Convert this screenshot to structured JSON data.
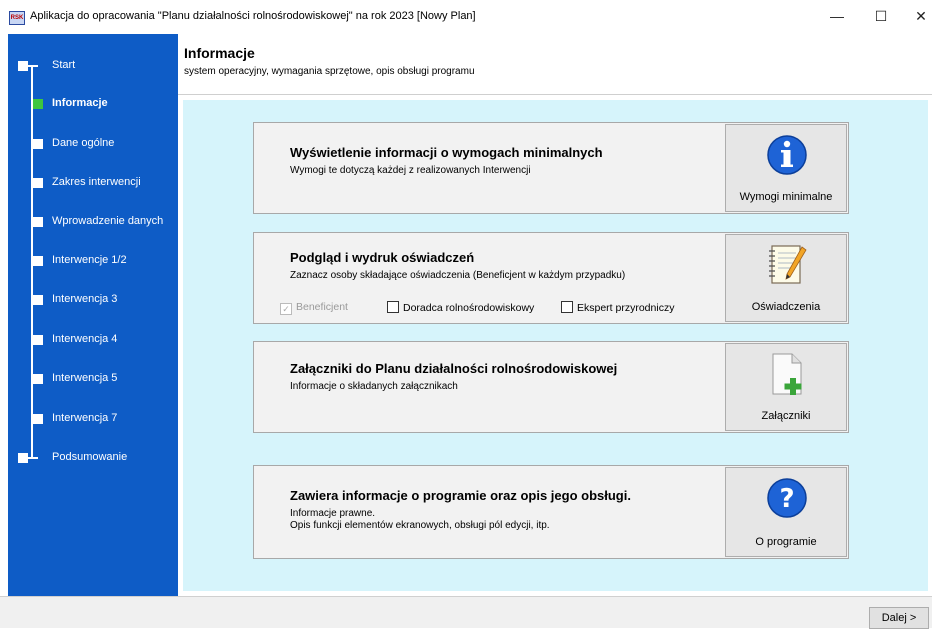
{
  "window": {
    "title": "Aplikacja do opracowania \"Planu działalności rolnośrodowiskowej\" na rok 2023  [Nowy Plan]",
    "icon_text": "RSK",
    "minimize": "—",
    "maximize": "☐",
    "close": "✕"
  },
  "sidebar": {
    "items": [
      {
        "label": "Start"
      },
      {
        "label": "Informacje"
      },
      {
        "label": "Dane ogólne"
      },
      {
        "label": "Zakres interwencji"
      },
      {
        "label": "Wprowadzenie danych"
      },
      {
        "label": "Interwencje 1/2"
      },
      {
        "label": "Interwencja 3"
      },
      {
        "label": "Interwencja 4"
      },
      {
        "label": "Interwencja 5"
      },
      {
        "label": "Interwencja 7"
      },
      {
        "label": "Podsumowanie"
      }
    ],
    "active_color": "#3ec63e"
  },
  "header": {
    "title": "Informacje",
    "subtitle": "system operacyjny, wymagania sprzętowe, opis obsługi programu"
  },
  "panels": [
    {
      "title": "Wyświetlenie informacji o wymogach minimalnych",
      "desc": "Wymogi te dotyczą każdej z realizowanych Interwencji",
      "button": "Wymogi minimalne",
      "icon": "info-icon"
    },
    {
      "title": "Podgląd i wydruk oświadczeń",
      "desc": "Zaznacz osoby składające oświadczenia (Beneficjent w każdym przypadku)",
      "button": "Oświadczenia",
      "icon": "notepad-icon",
      "checkboxes": [
        {
          "label": "Beneficjent",
          "checked": true,
          "disabled": true
        },
        {
          "label": "Doradca rolnośrodowiskowy",
          "checked": false,
          "disabled": false
        },
        {
          "label": "Ekspert przyrodniczy",
          "checked": false,
          "disabled": false
        }
      ]
    },
    {
      "title": "Załączniki do Planu działalności rolnośrodowiskowej",
      "desc": "Informacje o składanych załącznikach",
      "button": "Załączniki",
      "icon": "document-add-icon"
    },
    {
      "title": "Zawiera informacje o programie oraz opis jego obsługi.",
      "desc1": "Informacje prawne.",
      "desc2": "Opis funkcji elementów ekranowych, obsługi pól edycji, itp.",
      "button": "O programie",
      "icon": "question-icon"
    }
  ],
  "footer": {
    "next": "Dalej >"
  }
}
